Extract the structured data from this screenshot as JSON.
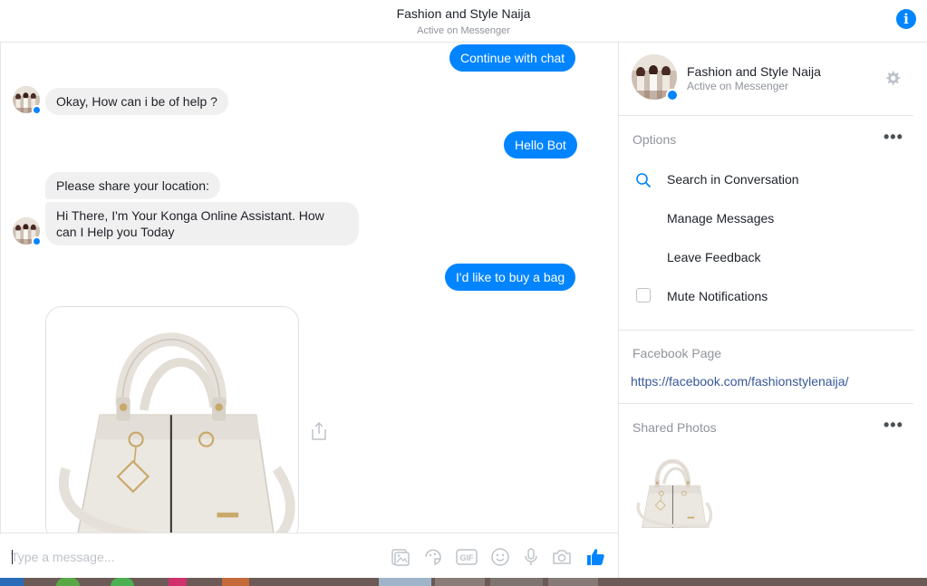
{
  "header": {
    "title": "Fashion and Style Naija",
    "subtitle": "Active on Messenger"
  },
  "messages": [
    {
      "direction": "out",
      "text": "Continue with chat"
    },
    {
      "direction": "in",
      "text": "Okay, How can i be of help ?"
    },
    {
      "direction": "out",
      "text": "Hello Bot"
    },
    {
      "direction": "in",
      "text": "Please share your location:"
    },
    {
      "direction": "in",
      "text": "Hi There, I'm Your Konga Online Assistant. How can I Help you Today"
    },
    {
      "direction": "out",
      "text": "I'd like to buy a bag"
    },
    {
      "direction": "in",
      "type": "image",
      "description": "product-handbag"
    }
  ],
  "composer": {
    "placeholder": "Type a message...",
    "icons": [
      "photo-icon",
      "sticker-icon",
      "gif-icon",
      "emoji-icon",
      "microphone-icon",
      "camera-icon",
      "like-icon"
    ]
  },
  "sidebar": {
    "profile": {
      "name": "Fashion and Style Naija",
      "status": "Active on Messenger"
    },
    "options": {
      "title": "Options",
      "items": [
        {
          "label": "Search in Conversation",
          "icon": "search-icon"
        },
        {
          "label": "Manage Messages"
        },
        {
          "label": "Leave Feedback"
        },
        {
          "label": "Mute Notifications",
          "icon": "checkbox"
        }
      ]
    },
    "facebook_page": {
      "title": "Facebook Page",
      "url": "https://facebook.com/fashionstylenaija/"
    },
    "shared_photos": {
      "title": "Shared Photos"
    }
  },
  "colors": {
    "accent": "#0084ff",
    "incoming_bubble": "#f1f0f0",
    "link": "#365899",
    "muted_text": "#90949c"
  }
}
